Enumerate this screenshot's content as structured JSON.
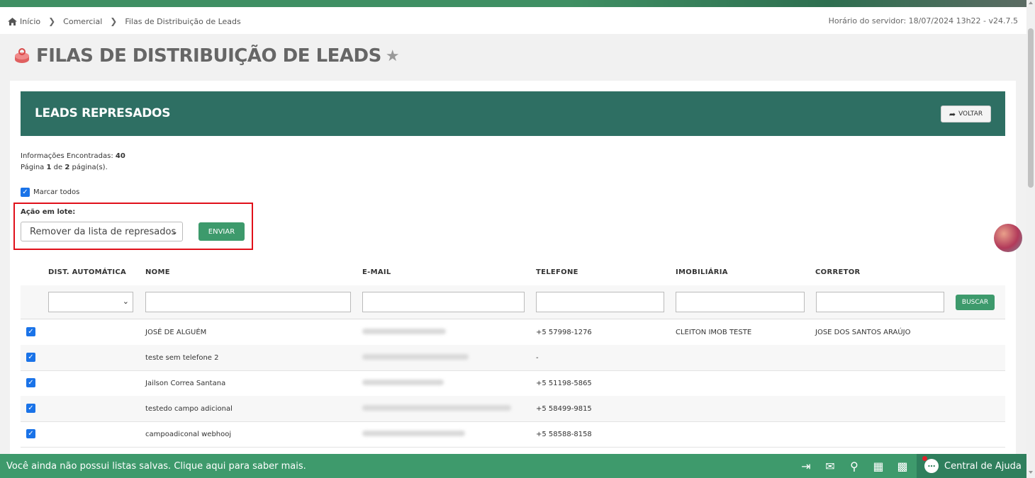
{
  "breadcrumb": {
    "home": "Início",
    "items": [
      "Comercial",
      "Filas de Distribuição de Leads"
    ]
  },
  "server_time": "Horário do servidor: 18/07/2024 13h22 - v24.7.5",
  "page": {
    "title": "FILAS DE DISTRIBUIÇÃO DE LEADS"
  },
  "panel": {
    "title": "LEADS REPRESADOS",
    "back_label": "VOLTAR"
  },
  "info": {
    "found_label": "Informações Encontradas:",
    "found_count": "40",
    "page_prefix": "Página",
    "page_current": "1",
    "page_of": "de",
    "page_total": "2",
    "page_suffix": "página(s)."
  },
  "select_all": {
    "label": "Marcar todos",
    "checked": true
  },
  "batch": {
    "label": "Ação em lote:",
    "selected_option": "Remover da lista de represados",
    "send_label": "ENVIAR"
  },
  "table": {
    "headers": [
      "DIST. AUTOMÁTICA",
      "NOME",
      "E-MAIL",
      "TELEFONE",
      "IMOBILIÁRIA",
      "CORRETOR"
    ],
    "search_label": "BUSCAR",
    "rows": [
      {
        "checked": true,
        "name": "JOSÉ DE ALGUÉM",
        "phone": "+5 57998-1276",
        "agency": "CLEITON IMOB TESTE",
        "broker": "JOSE DOS SANTOS ARAÚJO"
      },
      {
        "checked": true,
        "name": "teste sem telefone 2",
        "phone": "-",
        "agency": "",
        "broker": ""
      },
      {
        "checked": true,
        "name": "Jailson Correa Santana",
        "phone": "+5 51198-5865",
        "agency": "",
        "broker": ""
      },
      {
        "checked": true,
        "name": "testedo campo adicional",
        "phone": "+5 58499-9815",
        "agency": "",
        "broker": ""
      },
      {
        "checked": true,
        "name": "campoadiconal webhooj",
        "phone": "+5 58588-8158",
        "agency": "",
        "broker": ""
      }
    ]
  },
  "footer": {
    "message": "Você ainda não possui listas salvas. Clique aqui para saber mais.",
    "help_label": "Central de Ajuda"
  },
  "icons": {
    "exit": "exit-icon",
    "mail_star": "mail-star-icon",
    "bell": "bell-icon",
    "calendar": "calendar-icon",
    "calculator": "calculator-icon",
    "chat": "chat-icon"
  },
  "colors": {
    "accent": "#3e9a6c",
    "banner": "#2e6f63",
    "highlight": "#e0101a"
  }
}
